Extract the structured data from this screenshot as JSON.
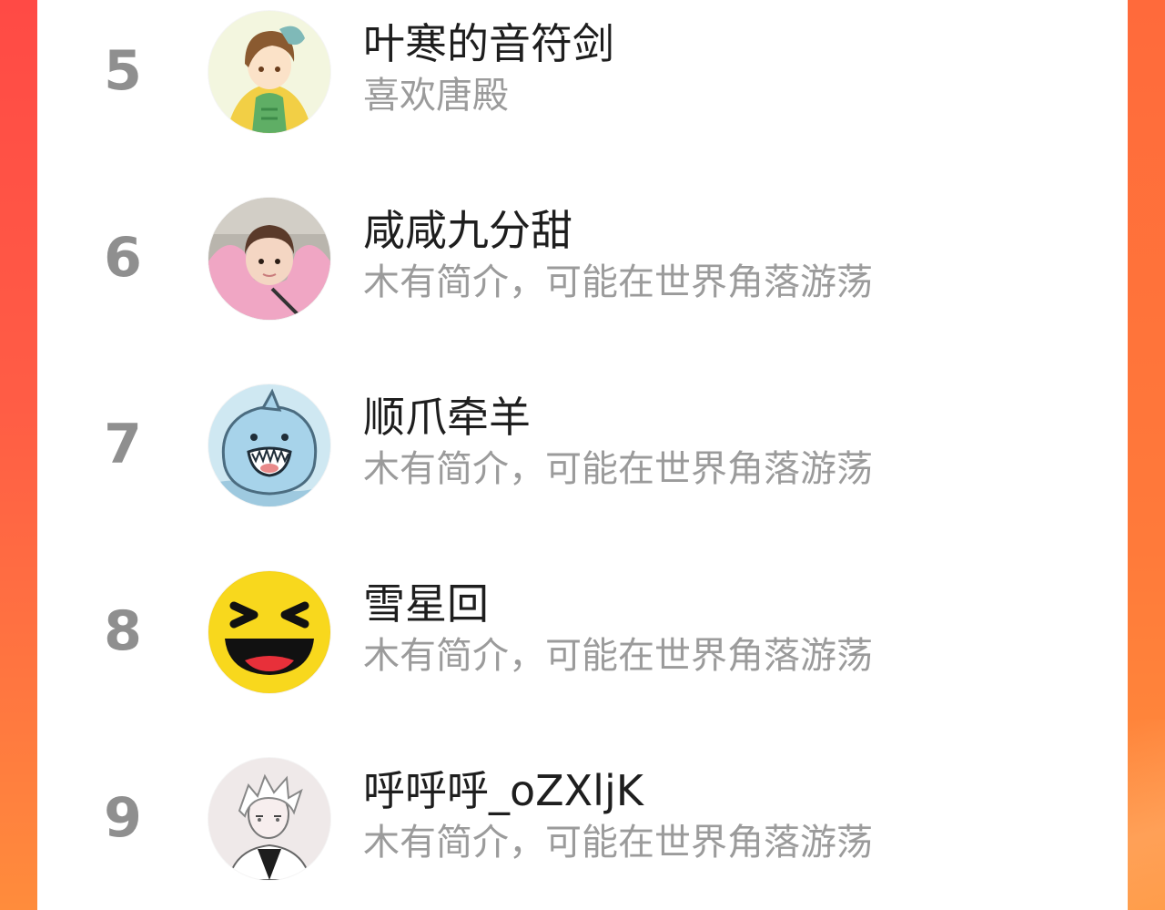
{
  "ranking": {
    "entries": [
      {
        "rank": "5",
        "name": "叶寒的音符剑",
        "bio": "喜欢唐殿",
        "avatar_icon": "anime-boy-avatar"
      },
      {
        "rank": "6",
        "name": "咸咸九分甜",
        "bio": "木有简介，可能在世界角落游荡",
        "avatar_icon": "child-photo-avatar"
      },
      {
        "rank": "7",
        "name": "顺爪牵羊",
        "bio": "木有简介，可能在世界角落游荡",
        "avatar_icon": "shark-cartoon-avatar"
      },
      {
        "rank": "8",
        "name": "雪星回",
        "bio": "木有简介，可能在世界角落游荡",
        "avatar_icon": "laughing-emoji-avatar"
      },
      {
        "rank": "9",
        "name": "呼呼呼_oZXljK",
        "bio": "木有简介，可能在世界角落游荡",
        "avatar_icon": "white-hair-boy-avatar"
      }
    ]
  },
  "colors": {
    "background_gradient_start": "#ff4a45",
    "background_gradient_end": "#ff8c3c",
    "panel": "#ffffff",
    "rank_text": "#8f8f8f",
    "name_text": "#1e1e1e",
    "bio_text": "#9b9b9b"
  }
}
